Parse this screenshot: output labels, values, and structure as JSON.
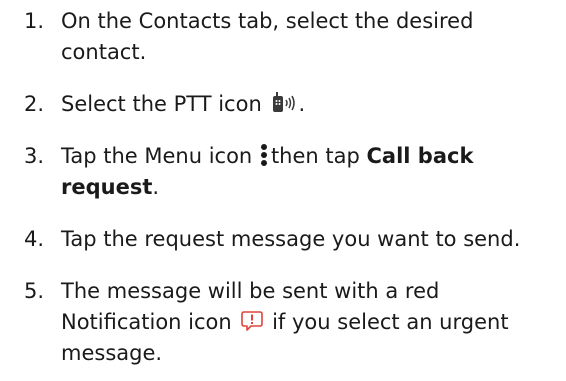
{
  "steps": [
    {
      "number": "1.",
      "text": "On the Contacts tab, select the desired contact."
    },
    {
      "number": "2.",
      "text_before": "Select the PTT icon",
      "icon": "ptt-radio-icon",
      "text_after": "."
    },
    {
      "number": "3.",
      "text_before": "Tap the Menu icon",
      "icon": "more-vertical-icon",
      "text_middle": "then tap",
      "bold_text": "Call back request",
      "text_after": "."
    },
    {
      "number": "4.",
      "text": "Tap the request message you want to send."
    },
    {
      "number": "5.",
      "text_before": "The message will be sent with a red Notification icon",
      "icon": "urgent-notification-icon",
      "text_after": "if you select an urgent message.",
      "icon_color": "#e0453a"
    }
  ]
}
